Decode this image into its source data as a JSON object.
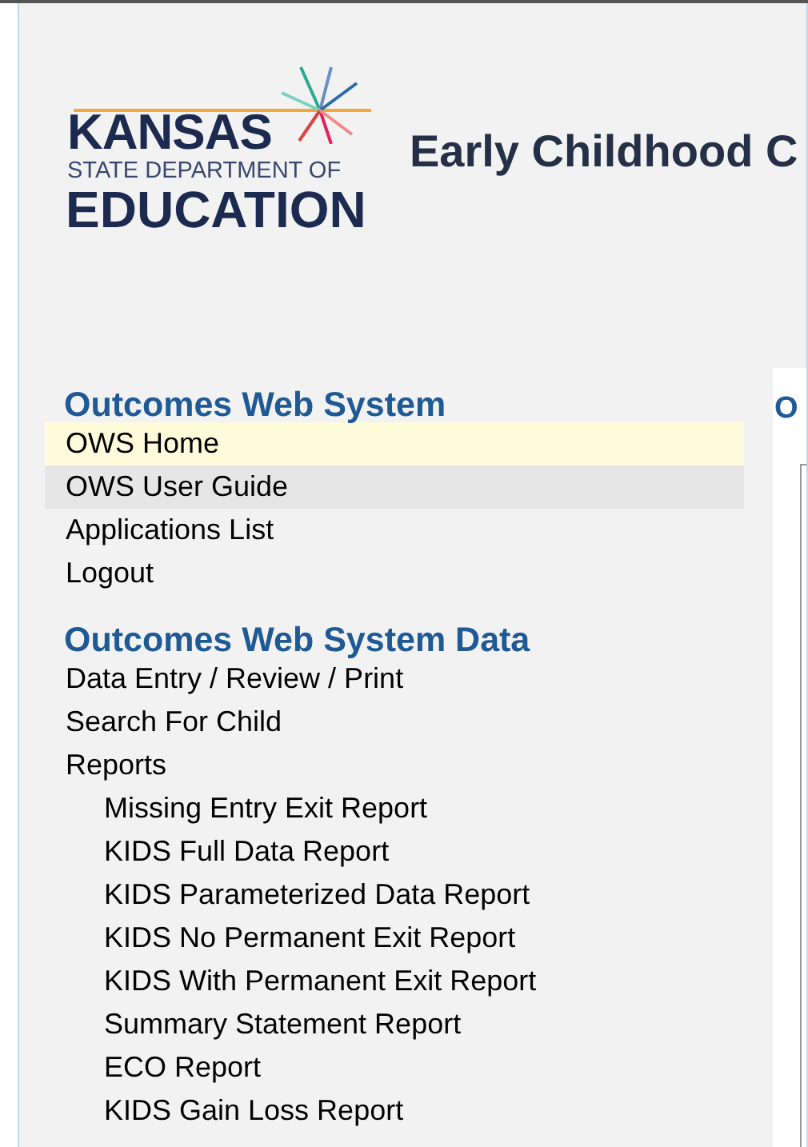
{
  "logo": {
    "line_1": "KANSAS",
    "line_2": "STATE DEPARTMENT OF",
    "line_3": "EDUCATION"
  },
  "header": {
    "title": "Early Childhood C"
  },
  "sidebar": {
    "sections": [
      {
        "heading": "Outcomes Web System",
        "items": [
          {
            "label": "OWS Home",
            "selected": true,
            "hovered": false
          },
          {
            "label": "OWS User Guide",
            "selected": false,
            "hovered": true
          },
          {
            "label": "Applications List",
            "selected": false,
            "hovered": false
          },
          {
            "label": "Logout",
            "selected": false,
            "hovered": false
          }
        ]
      },
      {
        "heading": "Outcomes Web System Data",
        "items": [
          {
            "label": "Data Entry / Review / Print",
            "selected": false,
            "hovered": false
          },
          {
            "label": "Search For Child",
            "selected": false,
            "hovered": false
          },
          {
            "label": "Reports",
            "selected": false,
            "hovered": false,
            "children": [
              {
                "label": "Missing Entry Exit Report",
                "selected": false,
                "hovered": false
              },
              {
                "label": "KIDS Full Data Report",
                "selected": false,
                "hovered": false
              },
              {
                "label": "KIDS Parameterized Data Report",
                "selected": false,
                "hovered": false
              },
              {
                "label": "KIDS No Permanent Exit Report",
                "selected": false,
                "hovered": false
              },
              {
                "label": "KIDS With Permanent Exit Report",
                "selected": false,
                "hovered": false
              },
              {
                "label": "Summary Statement Report",
                "selected": false,
                "hovered": false
              },
              {
                "label": "ECO Report",
                "selected": false,
                "hovered": false
              },
              {
                "label": "KIDS Gain Loss Report",
                "selected": false,
                "hovered": false
              }
            ]
          }
        ]
      }
    ]
  },
  "content": {
    "heading": "O"
  }
}
